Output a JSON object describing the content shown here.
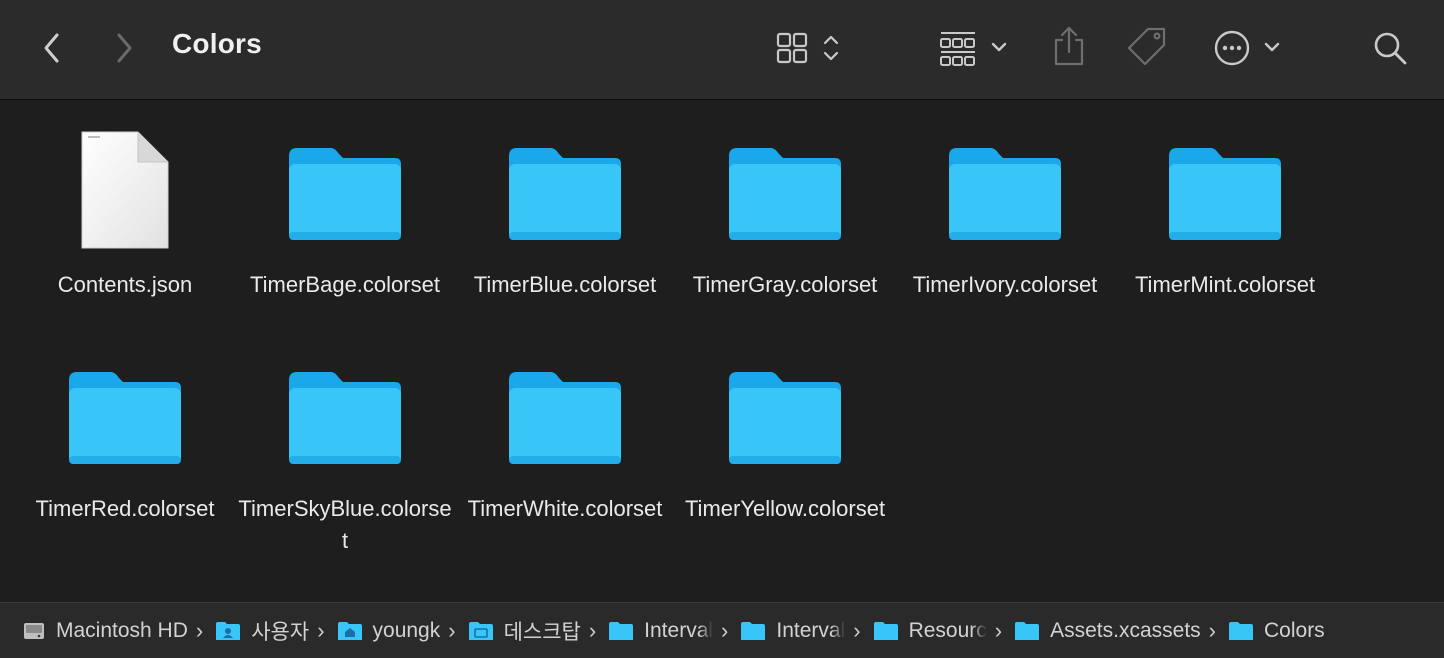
{
  "window": {
    "title": "Colors"
  },
  "toolbar": {
    "back": "chevron-left-icon",
    "forward": "chevron-right-icon",
    "view": "icon-grid-view-icon",
    "group": "group-by-icon",
    "share": "share-icon",
    "tag": "tag-icon",
    "more": "ellipsis-circle-icon",
    "search": "search-icon"
  },
  "colors": {
    "folder": "#38c5f8",
    "folderTab": "#1aa8ea",
    "background": "#1e1e1e"
  },
  "files": [
    {
      "name": "Contents.json",
      "kind": "document"
    },
    {
      "name": "TimerBage.colorset",
      "kind": "folder"
    },
    {
      "name": "TimerBlue.colorset",
      "kind": "folder"
    },
    {
      "name": "TimerGray.colorset",
      "kind": "folder"
    },
    {
      "name": "TimerIvory.colorset",
      "kind": "folder"
    },
    {
      "name": "TimerMint.colorset",
      "kind": "folder"
    },
    {
      "name": "TimerRed.colorset",
      "kind": "folder"
    },
    {
      "name": "TimerSkyBlue.colorset",
      "kind": "folder"
    },
    {
      "name": "TimerWhite.colorset",
      "kind": "folder"
    },
    {
      "name": "TimerYellow.colorset",
      "kind": "folder"
    }
  ],
  "path": [
    {
      "name": "Macintosh HD",
      "icon": "hard-drive-icon"
    },
    {
      "name": "사용자",
      "icon": "users-folder-icon"
    },
    {
      "name": "youngk",
      "icon": "home-folder-icon"
    },
    {
      "name": "데스크탑",
      "icon": "desktop-folder-icon"
    },
    {
      "name": "Interval",
      "icon": "folder-icon",
      "truncated": true
    },
    {
      "name": "Interval",
      "icon": "folder-icon",
      "truncated": true
    },
    {
      "name": "Resourc",
      "icon": "folder-icon",
      "truncated": true
    },
    {
      "name": "Assets.xcassets",
      "icon": "folder-icon"
    },
    {
      "name": "Colors",
      "icon": "folder-icon"
    }
  ]
}
